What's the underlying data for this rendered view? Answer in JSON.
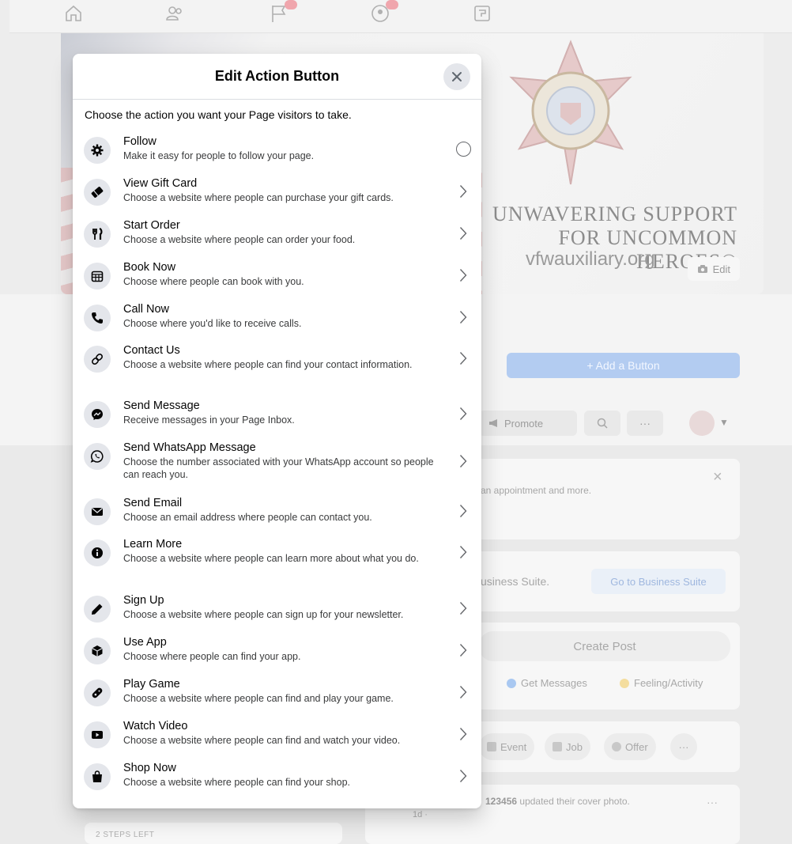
{
  "cover": {
    "slogan_line1": "UNWAVERING SUPPORT",
    "slogan_line2": "FOR UNCOMMON HEROES®",
    "website": "vfwauxiliary.org",
    "edit_label": "Edit"
  },
  "page": {
    "add_button_label": "+ Add a Button",
    "promote_label": "Promote",
    "more_label": "···",
    "card1_text": "an appointment and more.",
    "card2_text": "usiness Suite.",
    "business_suite_label": "Go to Business Suite",
    "create_post_label": "Create Post",
    "get_messages_label": "Get Messages",
    "feeling_label": "Feeling/Activity",
    "chips": [
      "Event",
      "Job",
      "Offer"
    ],
    "feed_name": "123456",
    "feed_text": "updated their cover photo.",
    "feed_time": "1d ·",
    "steps_left": "2 STEPS LEFT"
  },
  "modal": {
    "title": "Edit Action Button",
    "instruction": "Choose the action you want your Page visitors to take.",
    "options": [
      {
        "title": "Follow",
        "desc": "Make it easy for people to follow your page.",
        "icon": "gear-icon",
        "control": "radio"
      },
      {
        "title": "View Gift Card",
        "desc": "Choose a website where people can purchase your gift cards.",
        "icon": "gift-card-icon",
        "control": "chevron"
      },
      {
        "title": "Start Order",
        "desc": "Choose a website where people can order your food.",
        "icon": "utensils-icon",
        "control": "chevron"
      },
      {
        "title": "Book Now",
        "desc": "Choose where people can book with you.",
        "icon": "calendar-icon",
        "control": "chevron"
      },
      {
        "title": "Call Now",
        "desc": "Choose where you'd like to receive calls.",
        "icon": "phone-icon",
        "control": "chevron"
      },
      {
        "title": "Contact Us",
        "desc": "Choose a website where people can find your contact information.",
        "icon": "link-icon",
        "control": "chevron"
      },
      {
        "title": "Send Message",
        "desc": "Receive messages in your Page Inbox.",
        "icon": "messenger-icon",
        "control": "chevron"
      },
      {
        "title": "Send WhatsApp Message",
        "desc": "Choose the number associated with your WhatsApp account so people can reach you.",
        "icon": "whatsapp-icon",
        "control": "chevron"
      },
      {
        "title": "Send Email",
        "desc": "Choose an email address where people can contact you.",
        "icon": "envelope-icon",
        "control": "chevron"
      },
      {
        "title": "Learn More",
        "desc": "Choose a website where people can learn more about what you do.",
        "icon": "info-icon",
        "control": "chevron"
      },
      {
        "title": "Sign Up",
        "desc": "Choose a website where people can sign up for your newsletter.",
        "icon": "pencil-icon",
        "control": "chevron"
      },
      {
        "title": "Use App",
        "desc": "Choose where people can find your app.",
        "icon": "cube-icon",
        "control": "chevron"
      },
      {
        "title": "Play Game",
        "desc": "Choose a website where people can find and play your game.",
        "icon": "game-controller-icon",
        "control": "chevron"
      },
      {
        "title": "Watch Video",
        "desc": "Choose a website where people can find and watch your video.",
        "icon": "play-icon",
        "control": "chevron"
      },
      {
        "title": "Shop Now",
        "desc": "Choose a website where people can find your shop.",
        "icon": "shopping-bag-icon",
        "control": "chevron"
      }
    ]
  }
}
